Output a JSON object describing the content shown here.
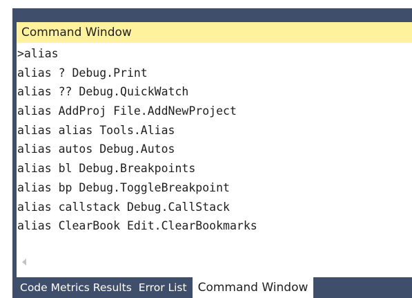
{
  "window": {
    "title": "Command Window"
  },
  "output": {
    "lines": [
      ">alias",
      "alias ? Debug.Print",
      "alias ?? Debug.QuickWatch",
      "alias AddProj File.AddNewProject",
      "alias alias Tools.Alias",
      "alias autos Debug.Autos",
      "alias bl Debug.Breakpoints",
      "alias bp Debug.ToggleBreakpoint",
      "alias callstack Debug.CallStack",
      "alias ClearBook Edit.ClearBookmarks"
    ]
  },
  "scrollbar": {
    "left_arrow_icon": "triangle-left-icon"
  },
  "tabs": [
    {
      "label": "Code Metrics Results",
      "active": false
    },
    {
      "label": "Error List",
      "active": false
    },
    {
      "label": "Command Window",
      "active": true
    }
  ],
  "colors": {
    "frame": "#3f4f6b",
    "title_bar": "#fff29d",
    "text": "#1e1e1e",
    "inactive_tab_text": "#ffffff",
    "active_tab_bg": "#ffffff"
  }
}
